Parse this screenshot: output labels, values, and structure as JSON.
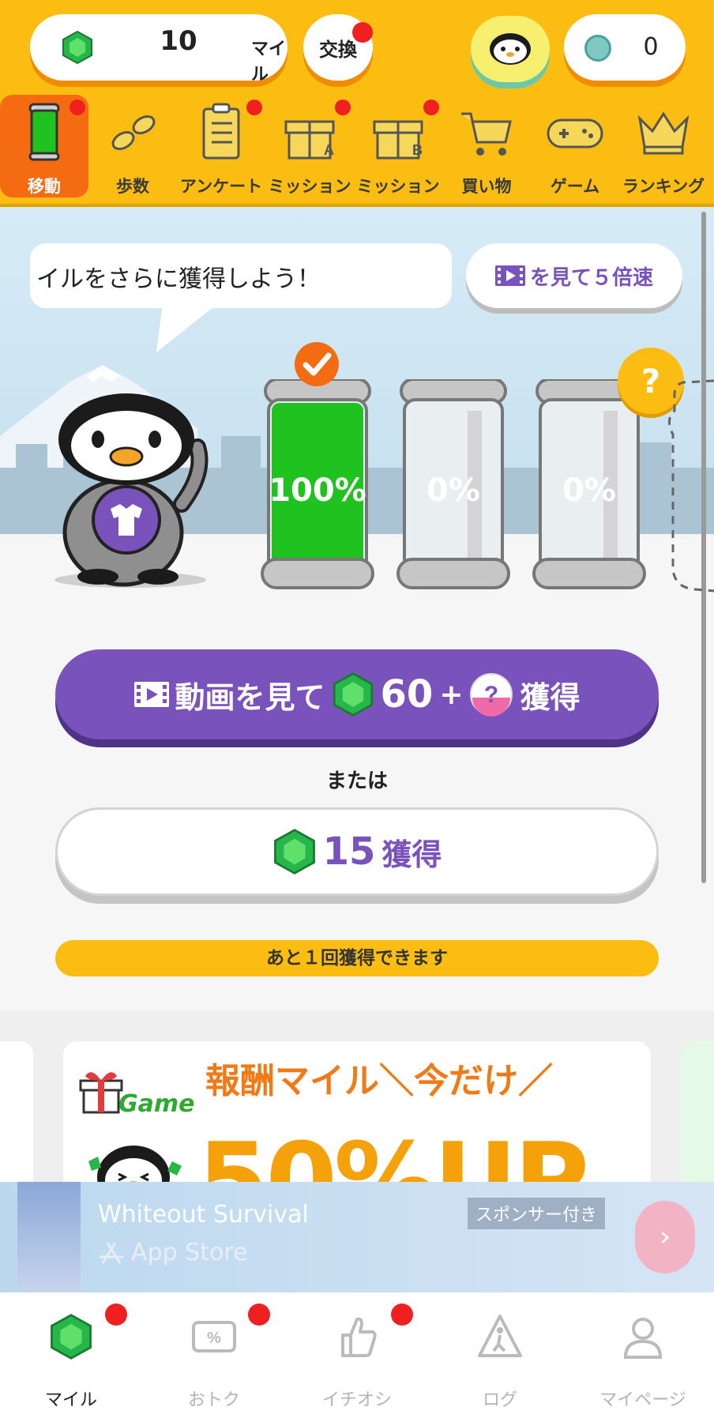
{
  "header": {
    "miles_value": "10",
    "miles_unit": "マイル",
    "exchange_label": "交換",
    "coin_value": "0"
  },
  "nav": [
    {
      "label": "移動",
      "icon": "battery-icon",
      "active": true,
      "badge": true
    },
    {
      "label": "歩数",
      "icon": "footprints-icon",
      "active": false,
      "badge": false
    },
    {
      "label": "アンケート",
      "icon": "clipboard-icon",
      "active": false,
      "badge": true
    },
    {
      "label": "ミッション",
      "icon": "gift-a-icon",
      "active": false,
      "badge": true
    },
    {
      "label": "ミッション",
      "icon": "gift-b-icon",
      "active": false,
      "badge": true
    },
    {
      "label": "買い物",
      "icon": "cart-icon",
      "active": false,
      "badge": false
    },
    {
      "label": "ゲーム",
      "icon": "gamepad-icon",
      "active": false,
      "badge": false
    },
    {
      "label": "ランキング",
      "icon": "crown-icon",
      "active": false,
      "badge": false
    }
  ],
  "scene": {
    "bubble_text": "イルをさらに獲得しよう！",
    "speed_label": "を見て５倍速",
    "batteries": [
      {
        "percent_label": "100%",
        "level": 1.0,
        "checked": true
      },
      {
        "percent_label": "0%",
        "level": 0.0,
        "checked": false
      },
      {
        "percent_label": "0%",
        "level": 0.0,
        "checked": false
      }
    ],
    "mystery_label": "?"
  },
  "actions": {
    "watch_text": "動画を見て",
    "watch_amount": "60",
    "watch_plus": "+",
    "watch_get": "獲得",
    "or_text": "または",
    "get_amount": "15",
    "get_label": "獲得",
    "remaining_text": "あと１回獲得できます"
  },
  "banner": {
    "headline": "報酬マイル＼今だけ／",
    "game_label": "Game",
    "big_text": "50%UP"
  },
  "ad": {
    "title": "Whiteout Survival",
    "store": "App Store",
    "sponsor": "スポンサー付き",
    "arrow": "›"
  },
  "tabs": [
    {
      "label": "マイル",
      "icon": "gem-icon",
      "active": true,
      "badge": true
    },
    {
      "label": "おトク",
      "icon": "coupon-icon",
      "active": false,
      "badge": true
    },
    {
      "label": "イチオシ",
      "icon": "thumbs-up-icon",
      "active": false,
      "badge": true
    },
    {
      "label": "ログ",
      "icon": "walker-sign-icon",
      "active": false,
      "badge": false
    },
    {
      "label": "マイページ",
      "icon": "person-icon",
      "active": false,
      "badge": false
    }
  ],
  "colors": {
    "header_yellow": "#fbbd12",
    "accent_purple": "#7a52bb",
    "active_orange": "#f46b12",
    "battery_green": "#1fc21f",
    "badge_red": "#f02020"
  }
}
